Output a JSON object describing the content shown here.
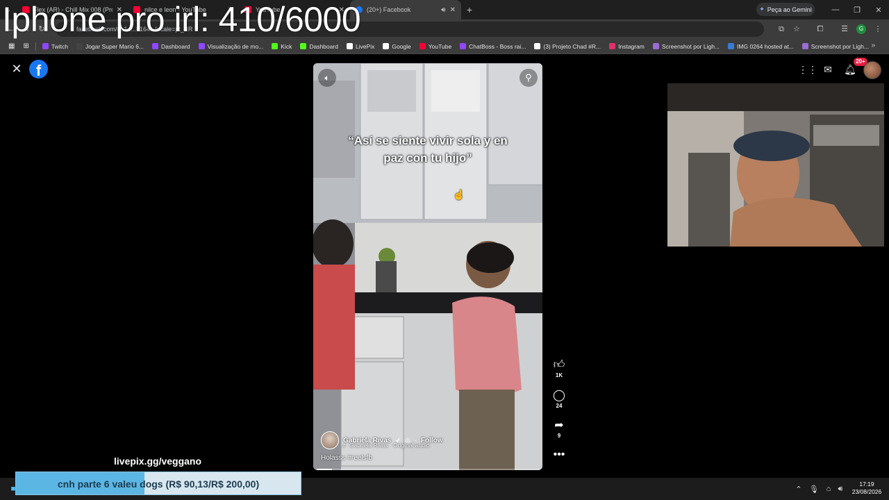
{
  "stream": {
    "title": "Iphone pro irl: 410/6000"
  },
  "browser": {
    "tabs": [
      {
        "title": "Flex (AR) - Chill Mix 008 (Progre",
        "active": false,
        "icon": "youtube-icon"
      },
      {
        "title": "nilce e leon - YouTube",
        "active": false,
        "icon": "youtube-icon"
      },
      {
        "title": "YouTube",
        "active": false,
        "icon": "youtube-icon"
      },
      {
        "title": "(20+) Facebook",
        "active": true,
        "icon": "facebook-icon"
      }
    ],
    "gemini_label": "Peça ao Gemini",
    "url": "facebook.com/r...14...8164...locale=pt_BR",
    "profile_initial": "G",
    "bookmarks": [
      {
        "label": "Twitch",
        "color": "#9146ff"
      },
      {
        "label": "Jogar Super Mario 6...",
        "color": "#444"
      },
      {
        "label": "Dashboard",
        "color": "#9146ff"
      },
      {
        "label": "Visualização de mo...",
        "color": "#9146ff"
      },
      {
        "label": "Kick",
        "color": "#53fc18"
      },
      {
        "label": "Dashboard",
        "color": "#53fc18"
      },
      {
        "label": "LivePix",
        "color": "#ffffff"
      },
      {
        "label": "Google",
        "color": "#ffffff"
      },
      {
        "label": "YouTube",
        "color": "#ff0033"
      },
      {
        "label": "ChatBoss - Boss rai...",
        "color": "#9146ff"
      },
      {
        "label": "(3) Projeto Chad #R...",
        "color": "#ffffff"
      },
      {
        "label": "Instagram",
        "color": "#e1306c"
      },
      {
        "label": "Screenshot por Ligh...",
        "color": "#9b6bd6"
      },
      {
        "label": "IMG 0264 hosted at...",
        "color": "#3a7bd5"
      },
      {
        "label": "Screenshot por Ligh...",
        "color": "#9b6bd6"
      }
    ]
  },
  "facebook": {
    "notification_count": "20+",
    "reel": {
      "caption": "“Así se siente vivir sola y en\npaz con tu hijo”",
      "author": "Gabriela Rivas",
      "follow_label": "Follow",
      "audio": "♬ Gabriela Rivas · Original audio",
      "description": "Holasss #reelsfb",
      "progress": 0.07,
      "likes": "1K",
      "comments": "24",
      "shares": "9"
    }
  },
  "overlay": {
    "livepix_url": "livepix.gg/veggano",
    "donation_goal_text": "cnh parte 6 valeu dogs (R$ 90,13/R$ 200,00)",
    "donation_progress": 0.45
  },
  "taskbar": {
    "time": "17:19",
    "date": "23/08/2026"
  }
}
